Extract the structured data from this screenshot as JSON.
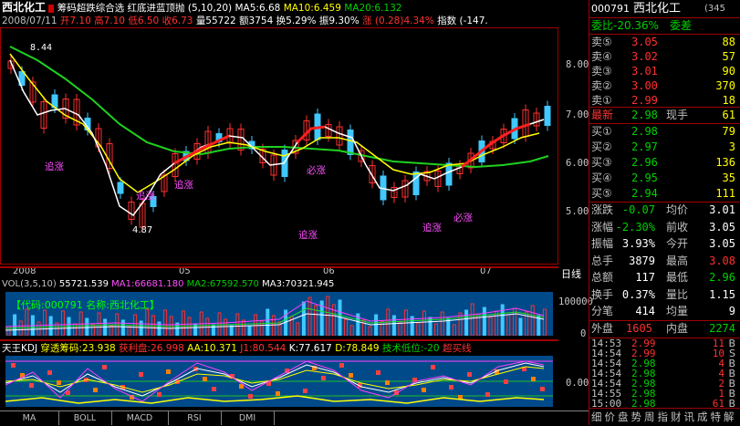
{
  "stock": {
    "name": "西北化工",
    "code": "000791",
    "page": "(345"
  },
  "header": {
    "title": "筹码超跌综合选",
    "strategy": "红底进蓝顶抛 (5,10,20)",
    "ma5": "MA5:6.68",
    "ma10": "MA10:6.459",
    "ma20": "MA20:6.132",
    "date": "2008/07/11",
    "open": "开7.10",
    "high": "高7.10",
    "low": "低6.50",
    "close": "收6.73",
    "volume": "量55722",
    "amount": "额3754",
    "turnover": "换5.29%",
    "amplitude": "振9.30%",
    "change": "涨 (0.28)4.34%",
    "index": "指数 (-147."
  },
  "price_chart": {
    "y_labels": [
      "8.00",
      "7.00",
      "6.00",
      "5.00"
    ],
    "x_labels": [
      "2008",
      "05",
      "06",
      "07"
    ],
    "high_mark": "8.44",
    "low_mark": "4.87",
    "signals": [
      "追涨",
      "追涨",
      "追涨",
      "必涨",
      "追涨",
      "追涨",
      "必涨"
    ],
    "right_tag": "日线"
  },
  "volume_panel": {
    "header": "VOL(3,5,10)",
    "vol": "55721.539",
    "ma1": "MA1:66681.180",
    "ma2": "MA2:67592.570",
    "ma3": "MA3:70321.945",
    "info_box": "【代码:000791  名称:西北化工】",
    "y_labels": [
      "100000",
      "0"
    ]
  },
  "kdj_panel": {
    "title": "天王KDJ",
    "penetrate": "穿透筹码:23.938",
    "earn_rate": "获利盘:26.998",
    "aa": "AA:10.371",
    "j1": "J1:80.544",
    "k": "K:77.617",
    "d": "D:78.849",
    "low_level": "技术低位:-20",
    "super_buy": "超买线",
    "y_labels": [
      "0.00"
    ]
  },
  "quote": {
    "weibi": "委比-20.36%",
    "weicha": "委差",
    "asks": [
      {
        "label": "卖⑤",
        "price": "3.05",
        "vol": "88"
      },
      {
        "label": "卖④",
        "price": "3.02",
        "vol": "57"
      },
      {
        "label": "卖③",
        "price": "3.01",
        "vol": "90"
      },
      {
        "label": "卖②",
        "price": "3.00",
        "vol": "370"
      },
      {
        "label": "卖①",
        "price": "2.99",
        "vol": "18"
      }
    ],
    "last_label": "最新",
    "last": "2.98",
    "now_hand_label": "现手",
    "now_hand": "61",
    "bids": [
      {
        "label": "买①",
        "price": "2.98",
        "vol": "79"
      },
      {
        "label": "买②",
        "price": "2.97",
        "vol": "3"
      },
      {
        "label": "买③",
        "price": "2.96",
        "vol": "136"
      },
      {
        "label": "买④",
        "price": "2.95",
        "vol": "35"
      },
      {
        "label": "买⑤",
        "price": "2.94",
        "vol": "111"
      }
    ],
    "stats": [
      {
        "l1": "涨跌",
        "v1": "-0.07",
        "l2": "均价",
        "v2": "3.01"
      },
      {
        "l1": "涨幅",
        "v1": "-2.30%",
        "l2": "前收",
        "v2": "3.05"
      },
      {
        "l1": "振幅",
        "v1": "3.93%",
        "l2": "今开",
        "v2": "3.05"
      },
      {
        "l1": "总手",
        "v1": "3879",
        "l2": "最高",
        "v2": "3.08"
      },
      {
        "l1": "总额",
        "v1": "117",
        "l2": "最低",
        "v2": "2.96"
      },
      {
        "l1": "换手",
        "v1": "0.37%",
        "l2": "量比",
        "v2": "1.15"
      },
      {
        "l1": "分笔",
        "v1": "414",
        "l2": "均量",
        "v2": "9"
      }
    ],
    "outer_label": "外盘",
    "outer": "1605",
    "inner_label": "内盘",
    "inner": "2274",
    "ticks": [
      {
        "time": "14:53",
        "price": "2.99",
        "vol": "11",
        "dir": "B"
      },
      {
        "time": "14:54",
        "price": "2.99",
        "vol": "10",
        "dir": "S"
      },
      {
        "time": "14:54",
        "price": "2.98",
        "vol": "4",
        "dir": "B"
      },
      {
        "time": "14:54",
        "price": "2.98",
        "vol": "4",
        "dir": "B"
      },
      {
        "time": "14:54",
        "price": "2.98",
        "vol": "2",
        "dir": "B"
      },
      {
        "time": "14:55",
        "price": "2.98",
        "vol": "1",
        "dir": "B"
      },
      {
        "time": "15:00",
        "price": "2.98",
        "vol": "61",
        "dir": "B"
      }
    ],
    "footer_tabs": [
      "细",
      "价",
      "盘",
      "势",
      "周",
      "指",
      "财",
      "讯",
      "成",
      "特",
      "解"
    ]
  },
  "bottom_tabs": [
    "MA",
    "BOLL",
    "MACD",
    "RSI",
    "DMI"
  ]
}
